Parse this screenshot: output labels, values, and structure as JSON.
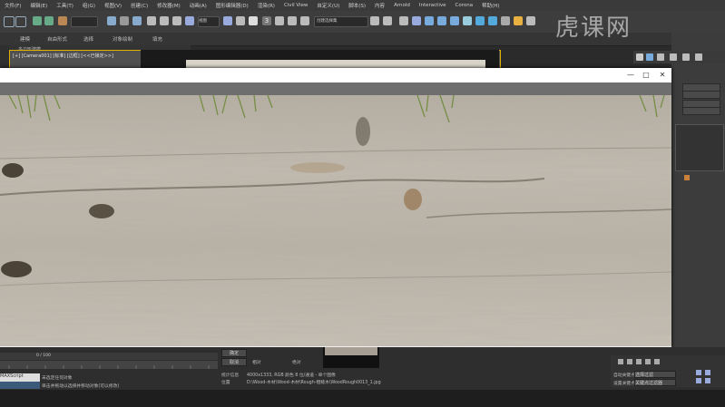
{
  "menu": [
    "文件(F)",
    "编辑(E)",
    "工具(T)",
    "组(G)",
    "视图(V)",
    "创建(C)",
    "修改器(M)",
    "动画(A)",
    "图形编辑器(D)",
    "渲染(R)",
    "Civil View",
    "自定义(U)",
    "脚本(S)",
    "内容",
    "Arnold",
    "Interactive",
    "Corona",
    "帮助(H)"
  ],
  "toolbar": {
    "selection_set": "创建选择集",
    "view_dropdown": "视图"
  },
  "ribbon": {
    "tab1": "建模",
    "tab2": "自由形式",
    "tab3": "选择",
    "tab4": "对象绘制",
    "tab5": "填充",
    "sub": "多边形建模"
  },
  "viewport": {
    "label": "[+] [Camera001] [标准] [边框] [<<已锁定>>]"
  },
  "watermark": "虎课网",
  "image_window": {
    "minimize": "—",
    "maximize": "□",
    "close": "✕"
  },
  "bottom": {
    "frame_counter": "0 / 100",
    "ok_button": "确定",
    "cancel_button": "取消",
    "radio_relative": "相对",
    "radio_absolute": "绝对",
    "stat_label": "MAXScript",
    "status_line1": "未选定任何对象",
    "status_line2": "单击并拖动以选择并移动对象(可以修改)",
    "info_label1": "统计信息",
    "info_value1": "4000x1333, RGB 颜色 8 位/通道 - 单个图像",
    "info_label2": "位置",
    "info_value2": "D:\\Wood-木材\\Wood-木材\\Rough-粗糙木\\WoodRough0013_1.jpg",
    "right_dd1": "选择过滤",
    "right_dd2": "关键点过滤器",
    "right_label1": "自动关键点",
    "right_label2": "设置关键点"
  }
}
